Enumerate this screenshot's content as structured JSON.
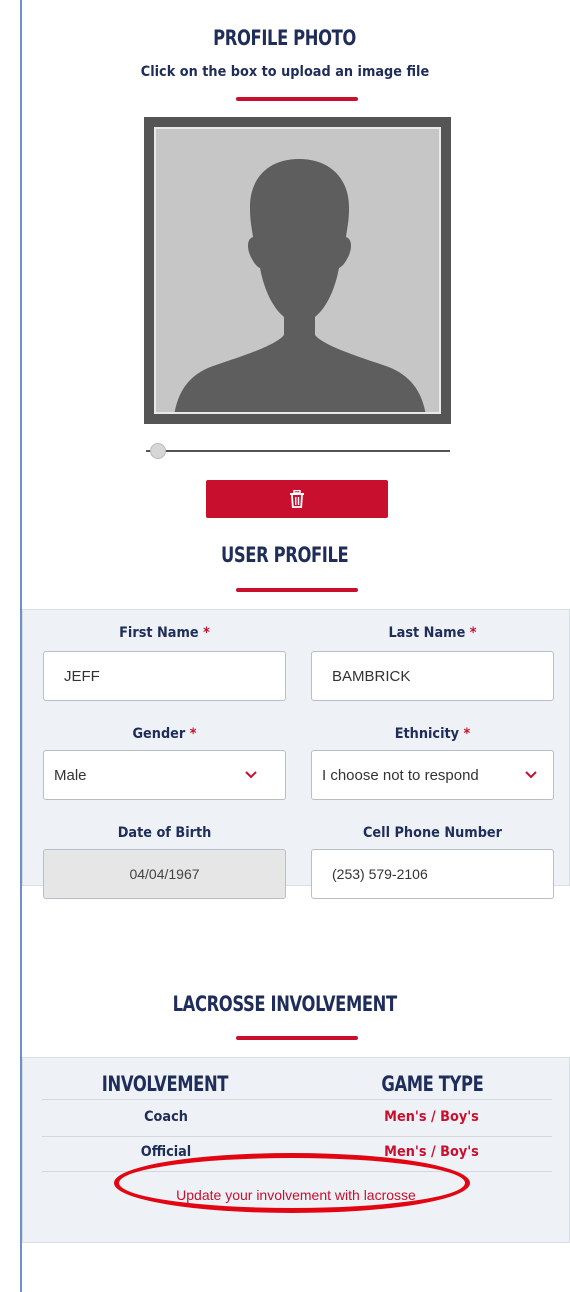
{
  "profile_photo": {
    "title": "PROFILE PHOTO",
    "subtitle": "Click on the box to upload an image file",
    "delete_icon": "trash-icon",
    "placeholder_icon": "silhouette-avatar-icon",
    "slider_level": 0.05
  },
  "user_profile": {
    "title": "USER PROFILE",
    "first_name": {
      "label": "First Name",
      "value": "JEFF",
      "required": "*"
    },
    "last_name": {
      "label": "Last Name",
      "value": "BAMBRICK",
      "required": "*"
    },
    "gender": {
      "label": "Gender",
      "value": "Male",
      "required": "*"
    },
    "ethnicity": {
      "label": "Ethnicity",
      "value": "I choose not to respond",
      "required": "*"
    },
    "dob": {
      "label": "Date of Birth",
      "value": "04/04/1967"
    },
    "phone": {
      "label": "Cell Phone Number",
      "value": "(253) 579-2106"
    }
  },
  "involvement": {
    "title": "LACROSSE INVOLVEMENT",
    "columns": [
      "INVOLVEMENT",
      "GAME TYPE"
    ],
    "rows": [
      {
        "involvement": "Coach",
        "game_type": "Men's / Boy's"
      },
      {
        "involvement": "Official",
        "game_type": "Men's / Boy's"
      }
    ],
    "update_link": "Update your involvement with lacrosse"
  },
  "colors": {
    "accent": "#c8102e",
    "navy": "#1f2d5a",
    "panel": "#eef1f5",
    "annotation": "#e20613"
  }
}
